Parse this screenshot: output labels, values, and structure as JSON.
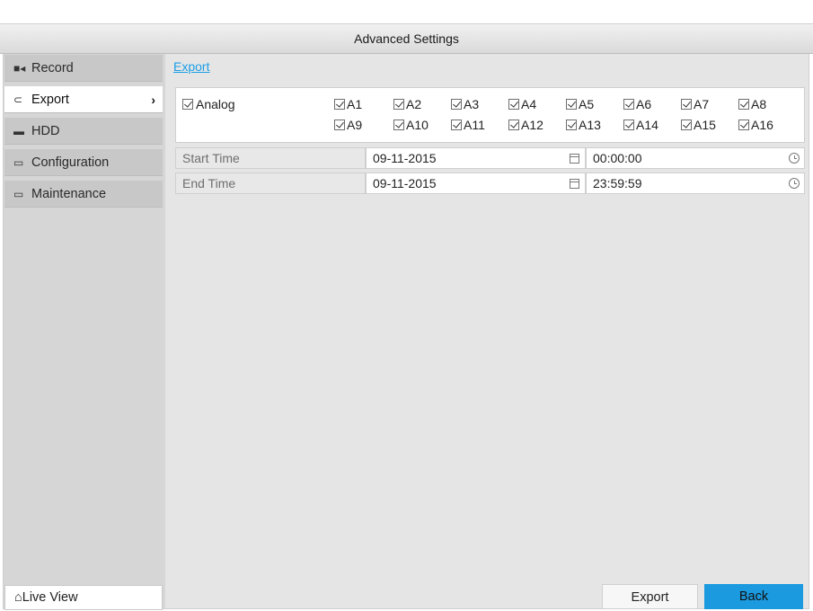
{
  "window": {
    "title": "Advanced Settings"
  },
  "sidebar": {
    "items": [
      {
        "label": "Record",
        "icon": "camera-icon",
        "active": false
      },
      {
        "label": "Export",
        "icon": "export-icon",
        "active": true
      },
      {
        "label": "HDD",
        "icon": "hdd-icon",
        "active": false
      },
      {
        "label": "Configuration",
        "icon": "configuration-icon",
        "active": false
      },
      {
        "label": "Maintenance",
        "icon": "maintenance-icon",
        "active": false
      }
    ],
    "live_view": {
      "label": "Live View",
      "icon": "home-icon"
    }
  },
  "main": {
    "tab": "Export",
    "channels": {
      "group_label": "Analog",
      "group_checked": true,
      "row1": [
        "A1",
        "A2",
        "A3",
        "A4",
        "A5",
        "A6",
        "A7",
        "A8"
      ],
      "row2": [
        "A9",
        "A10",
        "A11",
        "A12",
        "A13",
        "A14",
        "A15",
        "A16"
      ],
      "all_checked": true
    },
    "start": {
      "label": "Start Time",
      "date": "09-11-2015",
      "time": "00:00:00"
    },
    "end": {
      "label": "End Time",
      "date": "09-11-2015",
      "time": "23:59:59"
    }
  },
  "buttons": {
    "export": "Export",
    "back": "Back"
  },
  "colors": {
    "accent": "#1b9ae0",
    "link": "#1a9ee6",
    "sidebar": "#c8c8c8",
    "content_bg": "#e5e5e5"
  }
}
